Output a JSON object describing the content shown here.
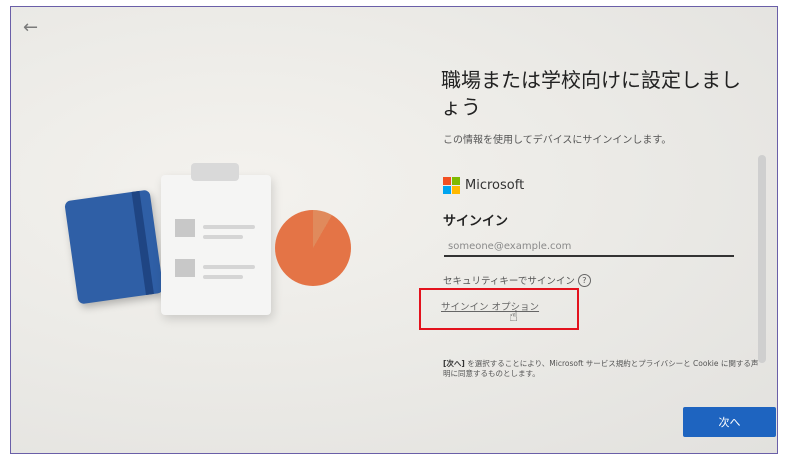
{
  "nav": {
    "back_icon": "←"
  },
  "header": {
    "title": "職場または学校向けに設定しましょう",
    "description": "この情報を使用してデバイスにサインインします。"
  },
  "brand": {
    "name": "Microsoft",
    "logo_colors": [
      "#f25022",
      "#7fba00",
      "#00a4ef",
      "#ffb900"
    ]
  },
  "signin": {
    "heading": "サインイン",
    "email_placeholder": "someone@example.com",
    "security_key_label": "セキュリティキーでサインイン",
    "help_icon": "?",
    "options_link": "サインイン オプション"
  },
  "consent": {
    "bold": "[次へ]",
    "text": " を選択することにより、Microsoft サービス規約とプライバシーと Cookie に関する声明に同意するものとします。"
  },
  "actions": {
    "next_label": "次へ"
  },
  "colors": {
    "accent": "#1e64c0",
    "highlight_box": "#e3121d"
  }
}
